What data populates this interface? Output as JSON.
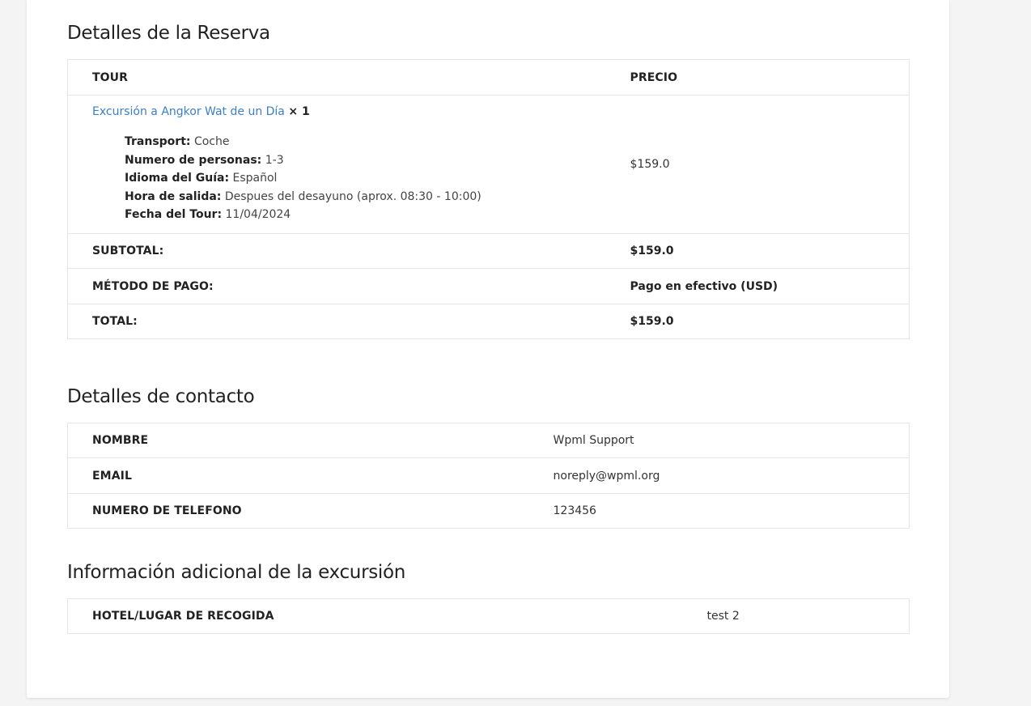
{
  "booking": {
    "title": "Detalles de la Reserva",
    "header": {
      "tour": "TOUR",
      "price": "PRECIO"
    },
    "item": {
      "name": "Excursión a Angkor Wat de un Día",
      "quantity": "× 1",
      "meta": [
        {
          "key": "Transport:",
          "value": "Coche"
        },
        {
          "key": "Numero de personas:",
          "value": "1-3"
        },
        {
          "key": "Idioma del Guía:",
          "value": "Español"
        },
        {
          "key": "Hora de salida:",
          "value": "Despues del desayuno (aprox. 08:30 - 10:00)"
        },
        {
          "key": "Fecha del Tour:",
          "value": "11/04/2024"
        }
      ],
      "price": "$159.0"
    },
    "subtotal": {
      "label": "SUBTOTAL:",
      "value": "$159.0"
    },
    "payment": {
      "label": "MÉTODO DE PAGO:",
      "value": "Pago en efectivo (USD)"
    },
    "total": {
      "label": "TOTAL:",
      "value": "$159.0"
    }
  },
  "contact": {
    "title": "Detalles de contacto",
    "rows": [
      {
        "label": "NOMBRE",
        "value": "Wpml Support"
      },
      {
        "label": "EMAIL",
        "value": "noreply@wpml.org"
      },
      {
        "label": "NUMERO DE TELEFONO",
        "value": "123456"
      }
    ]
  },
  "additional": {
    "title": "Información adicional de la excursión",
    "rows": [
      {
        "label": "HOTEL/LUGAR DE RECOGIDA",
        "value": "test 2"
      }
    ]
  }
}
